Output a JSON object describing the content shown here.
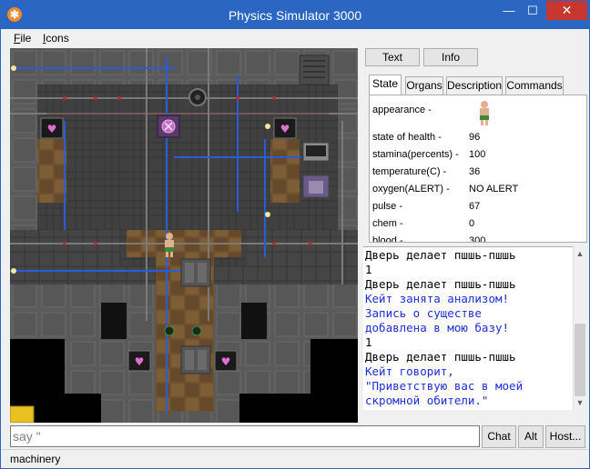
{
  "window": {
    "title": "Physics Simulator 3000",
    "minimize_glyph": "—",
    "maximize_glyph": "☐",
    "close_glyph": "✕",
    "app_icon": "orange-gear-icon"
  },
  "menu": {
    "file_first": "F",
    "file_rest": "ile",
    "icons_first": "I",
    "icons_rest": "cons"
  },
  "info_panel": {
    "text_button": "Text",
    "info_button": "Info",
    "tabs": [
      "State",
      "Organs",
      "Description",
      "Commands"
    ],
    "state_rows": [
      {
        "label": "appearance -",
        "value": ""
      },
      {
        "label": "state of health -",
        "value": "96"
      },
      {
        "label": "stamina(percents) -",
        "value": "100"
      },
      {
        "label": "temperature(C) -",
        "value": "36"
      },
      {
        "label": "oxygen(ALERT) -",
        "value": "NO ALERT"
      },
      {
        "label": "pulse -",
        "value": "67"
      },
      {
        "label": "chem -",
        "value": "0"
      },
      {
        "label": "blood -",
        "value": "300"
      }
    ]
  },
  "chat": {
    "lines": [
      {
        "text": "Дверь делает пшшь-пшшь",
        "color": "black"
      },
      {
        "text": "1",
        "color": "black"
      },
      {
        "text": "Дверь делает пшшь-пшшь",
        "color": "black"
      },
      {
        "text": "Кейт занята анализом!",
        "color": "blue"
      },
      {
        "text": "Запись о существе",
        "color": "blue"
      },
      {
        "text": "добавлена в мою базу!",
        "color": "blue"
      },
      {
        "text": "1",
        "color": "black"
      },
      {
        "text": "Дверь делает пшшь-пшшь",
        "color": "black"
      },
      {
        "text": "Кейт говорит,",
        "color": "blue"
      },
      {
        "text": "\"Приветствую вас в моей",
        "color": "blue"
      },
      {
        "text": "скромной обители.\"",
        "color": "blue"
      }
    ]
  },
  "input": {
    "value": "say \""
  },
  "buttons": {
    "chat": "Chat",
    "alt": "Alt",
    "host": "Host..."
  },
  "status": {
    "text": "machinery"
  },
  "colors": {
    "titlebar": "#2a66c2",
    "close": "#c7372f",
    "floor": "#3a3a3a",
    "wall": "#5c5c5c",
    "wood": "#7a5a32",
    "blue_pipe": "#2a5cd8",
    "chat_blue": "#1c2fd8"
  }
}
